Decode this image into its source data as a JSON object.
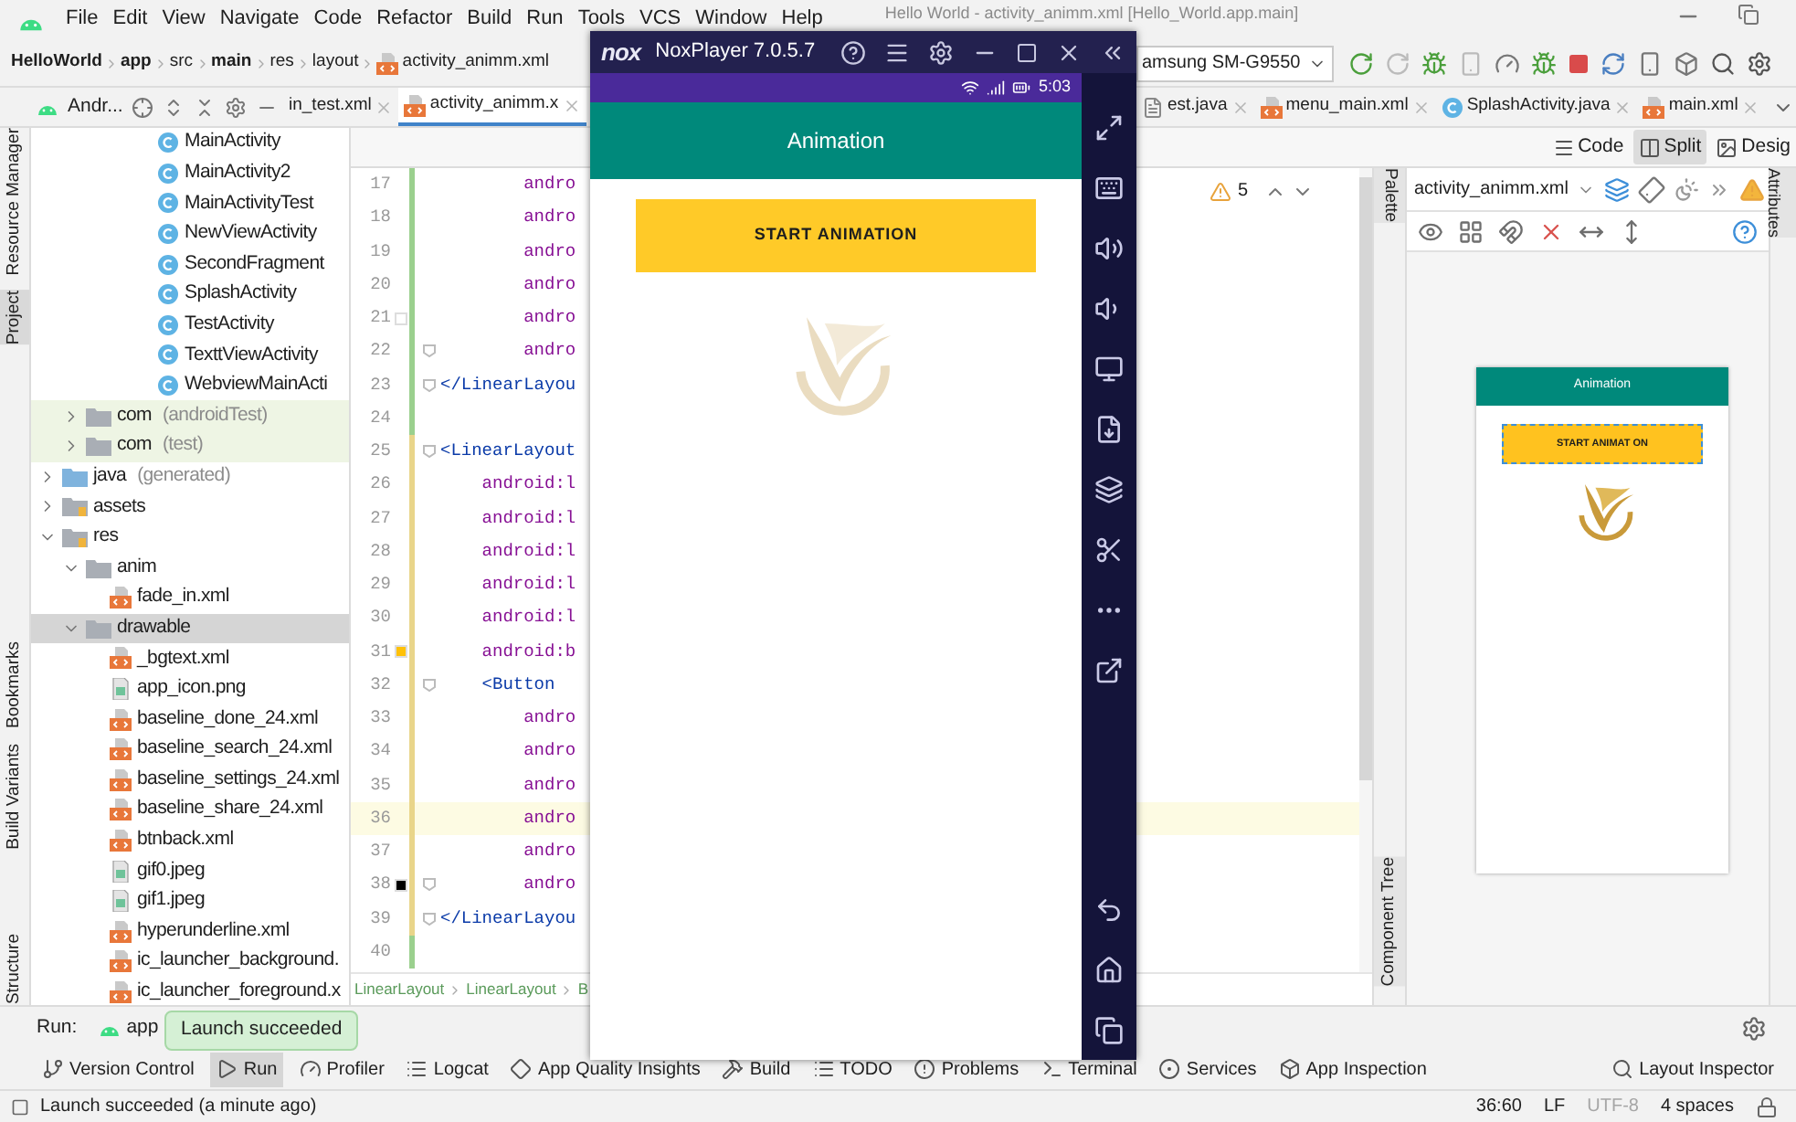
{
  "ide": {
    "menu": [
      "File",
      "Edit",
      "View",
      "Navigate",
      "Code",
      "Refactor",
      "Build",
      "Run",
      "Tools",
      "VCS",
      "Window",
      "Help"
    ],
    "title": "Hello World - activity_animm.xml [Hello_World.app.main]",
    "breadcrumb": [
      {
        "label": "HelloWorld",
        "bold": true
      },
      {
        "label": "app",
        "bold": true
      },
      {
        "label": "src",
        "bold": false
      },
      {
        "label": "main",
        "bold": true
      },
      {
        "label": "res",
        "bold": false
      },
      {
        "label": "layout",
        "bold": false
      },
      {
        "label": "activity_animm.xml",
        "bold": false,
        "kind": "xml"
      }
    ],
    "device": "amsung SM-G9550",
    "project_view": "Andr...",
    "tabs_left": [
      {
        "label": "in_test.xml",
        "selected": false
      },
      {
        "label": "activity_animm.x",
        "kind": "xml",
        "selected": true
      }
    ],
    "tabs_right": [
      {
        "label": "est.java",
        "kind": "plain",
        "selected": false
      },
      {
        "label": "menu_main.xml",
        "kind": "xml",
        "selected": false
      },
      {
        "label": "SplashActivity.java",
        "kind": "class",
        "selected": false
      },
      {
        "label": "main.xml",
        "kind": "xml",
        "selected": false
      }
    ],
    "view_modes": [
      {
        "label": "Code",
        "kind": "code",
        "selected": false
      },
      {
        "label": "Split",
        "kind": "split",
        "selected": true
      },
      {
        "label": "Desig",
        "kind": "design",
        "selected": false
      }
    ],
    "left_strip": [
      {
        "label": "Resource Manager",
        "selected": false
      },
      {
        "label": "Project",
        "selected": true
      },
      {
        "label": "Bookmarks",
        "selected": false
      },
      {
        "label": "Build Variants",
        "selected": false
      },
      {
        "label": "Structure",
        "selected": false
      }
    ],
    "tree": [
      {
        "children": [
          {
            "children": [
              {
                "children": [
                  {
                    "children": [
                      {
                        "label": "MainActivity",
                        "kind": "class",
                        "selected": false
                      },
                      {
                        "label": "MainActivity2",
                        "kind": "class",
                        "selected": false
                      },
                      {
                        "label": "MainActivityTest",
                        "kind": "class",
                        "selected": false
                      },
                      {
                        "label": "NewViewActivity",
                        "kind": "class",
                        "selected": false
                      },
                      {
                        "label": "SecondFragment",
                        "kind": "class",
                        "selected": false
                      },
                      {
                        "label": "SplashActivity",
                        "kind": "class",
                        "selected": false
                      },
                      {
                        "label": "TestActivity",
                        "kind": "class",
                        "selected": false
                      },
                      {
                        "label": "TexttViewActivity",
                        "kind": "class",
                        "selected": false
                      },
                      {
                        "label": "WebviewMainActi",
                        "kind": "class",
                        "selected": false
                      }
                    ]
                  }
                ]
              }
            ]
          },
          {
            "label": "com",
            "note": "(androidTest)",
            "kind": "test-package",
            "expanded": false,
            "selected": false
          },
          {
            "label": "com",
            "note": "(test)",
            "kind": "test-package",
            "expanded": false,
            "selected": false
          }
        ]
      },
      {
        "label": "java",
        "note": "(generated)",
        "kind": "generated",
        "expanded": false,
        "selected": false
      },
      {
        "label": "assets",
        "kind": "resource",
        "expanded": false,
        "selected": false
      },
      {
        "label": "res",
        "kind": "resource",
        "expanded": true,
        "selected": false,
        "children": [
          {
            "label": "anim",
            "kind": "folder",
            "expanded": true,
            "selected": false,
            "children": [
              {
                "label": "fade_in.xml",
                "kind": "xml",
                "selected": false
              }
            ]
          },
          {
            "label": "drawable",
            "kind": "folder",
            "expanded": true,
            "selected": true,
            "children": [
              {
                "label": "_bgtext.xml",
                "kind": "xml",
                "selected": false
              },
              {
                "label": "app_icon.png",
                "kind": "image",
                "selected": false
              },
              {
                "label": "baseline_done_24.xml",
                "kind": "xml",
                "selected": false
              },
              {
                "label": "baseline_search_24.xml",
                "kind": "xml",
                "selected": false
              },
              {
                "label": "baseline_settings_24.xml",
                "kind": "xml",
                "selected": false
              },
              {
                "label": "baseline_share_24.xml",
                "kind": "xml",
                "selected": false
              },
              {
                "label": "btnback.xml",
                "kind": "xml",
                "selected": false
              },
              {
                "label": "gif0.jpeg",
                "kind": "image",
                "selected": false
              },
              {
                "label": "gif1.jpeg",
                "kind": "image",
                "selected": false
              },
              {
                "label": "hyperunderline.xml",
                "kind": "xml",
                "selected": false
              },
              {
                "label": "ic_launcher_background.",
                "kind": "xml",
                "selected": false
              },
              {
                "label": "ic_launcher_foreground.x",
                "kind": "xml",
                "selected": false
              }
            ]
          }
        ]
      }
    ],
    "editor": {
      "warnings": "5",
      "lines": [
        {
          "number": "17",
          "code": "        andro",
          "kind": "attr",
          "modified": false,
          "current": false
        },
        {
          "number": "18",
          "code": "        andro",
          "kind": "attr",
          "modified": false,
          "current": false
        },
        {
          "number": "19",
          "code": "        andro",
          "kind": "attr",
          "modified": false,
          "current": false
        },
        {
          "number": "20",
          "code": "        andro",
          "kind": "attr",
          "modified": false,
          "current": false
        },
        {
          "number": "21",
          "code": "        andro",
          "kind": "attr",
          "modified": false,
          "current": false,
          "color": "#ffffff"
        },
        {
          "number": "22",
          "code": "        andro",
          "kind": "attr",
          "modified": false,
          "current": false,
          "fold": true
        },
        {
          "number": "23",
          "code": "</LinearLayou",
          "kind": "tag",
          "modified": false,
          "current": false,
          "fold": true
        },
        {
          "number": "24",
          "modified": false,
          "current": false
        },
        {
          "number": "25",
          "code": "<LinearLayout",
          "kind": "tag",
          "modified": true,
          "current": false,
          "fold": true
        },
        {
          "number": "26",
          "code": "    android:l",
          "kind": "attr",
          "modified": true,
          "current": false
        },
        {
          "number": "27",
          "code": "    android:l",
          "kind": "attr",
          "modified": true,
          "current": false
        },
        {
          "number": "28",
          "code": "    android:l",
          "kind": "attr",
          "modified": true,
          "current": false
        },
        {
          "number": "29",
          "code": "    android:l",
          "kind": "attr",
          "modified": true,
          "current": false
        },
        {
          "number": "30",
          "code": "    android:l",
          "kind": "attr",
          "modified": true,
          "current": false
        },
        {
          "number": "31",
          "code": "    android:b",
          "kind": "attr",
          "modified": true,
          "current": false,
          "color": "#ffc107"
        },
        {
          "number": "32",
          "code": "    <Button",
          "kind": "tag",
          "modified": true,
          "current": false,
          "fold": true
        },
        {
          "number": "33",
          "code": "        andro",
          "kind": "attr",
          "modified": true,
          "current": false
        },
        {
          "number": "34",
          "code": "        andro",
          "kind": "attr",
          "modified": true,
          "current": false
        },
        {
          "number": "35",
          "code": "        andro",
          "kind": "attr",
          "modified": true,
          "current": false
        },
        {
          "number": "36",
          "code": "        andro",
          "kind": "attr",
          "modified": true,
          "current": true
        },
        {
          "number": "37",
          "code": "        andro",
          "kind": "attr",
          "modified": true,
          "current": false
        },
        {
          "number": "38",
          "code": "        andro",
          "kind": "attr",
          "modified": true,
          "current": false,
          "color": "#000000",
          "fold": true
        },
        {
          "number": "39",
          "code": "</LinearLayou",
          "kind": "tag",
          "modified": true,
          "current": false,
          "fold": true
        },
        {
          "number": "40",
          "modified": false,
          "current": false
        }
      ],
      "path": [
        "LinearLayout",
        "LinearLayout",
        "B"
      ]
    },
    "design": {
      "file": "activity_animm.xml",
      "preview_title": "Animation",
      "preview_button": "START ANIMAT ON"
    },
    "right_strip": [
      {
        "label": "Palette",
        "selected": false
      },
      {
        "label": "Component Tree",
        "selected": false
      }
    ],
    "attributes_strip": {
      "label": "Attributes",
      "selected": false
    },
    "run_bar": {
      "label": "Run:",
      "tab": "app",
      "tooltip": "Launch succeeded"
    },
    "tool_windows": [
      {
        "label": "Version Control",
        "kind": "vcs",
        "selected": false
      },
      {
        "label": "Run",
        "kind": "run",
        "selected": true
      },
      {
        "label": "Profiler",
        "kind": "profiler",
        "selected": false
      },
      {
        "label": "Logcat",
        "kind": "logcat",
        "selected": false
      },
      {
        "label": "App Quality Insights",
        "kind": "insights",
        "selected": false
      },
      {
        "label": "Build",
        "kind": "build",
        "selected": false
      },
      {
        "label": "TODO",
        "kind": "todo",
        "selected": false
      },
      {
        "label": "Problems",
        "kind": "problems",
        "selected": false
      },
      {
        "label": "Terminal",
        "kind": "terminal",
        "selected": false
      },
      {
        "label": "Services",
        "kind": "services",
        "selected": false
      },
      {
        "label": "App Inspection",
        "kind": "inspection",
        "selected": false
      }
    ],
    "layout_inspector": "Layout Inspector",
    "status": {
      "message": "Launch succeeded (a minute ago)",
      "items": [
        {
          "label": "36:60",
          "disabled": false
        },
        {
          "label": "LF",
          "disabled": false
        },
        {
          "label": "UTF-8",
          "disabled": true
        },
        {
          "label": "4 spaces",
          "disabled": false
        }
      ]
    }
  },
  "nox": {
    "logo": "nox",
    "title": "NoxPlayer 7.0.5.7",
    "time": "5:03",
    "app_title": "Animation",
    "button": "START ANIMATION"
  }
}
